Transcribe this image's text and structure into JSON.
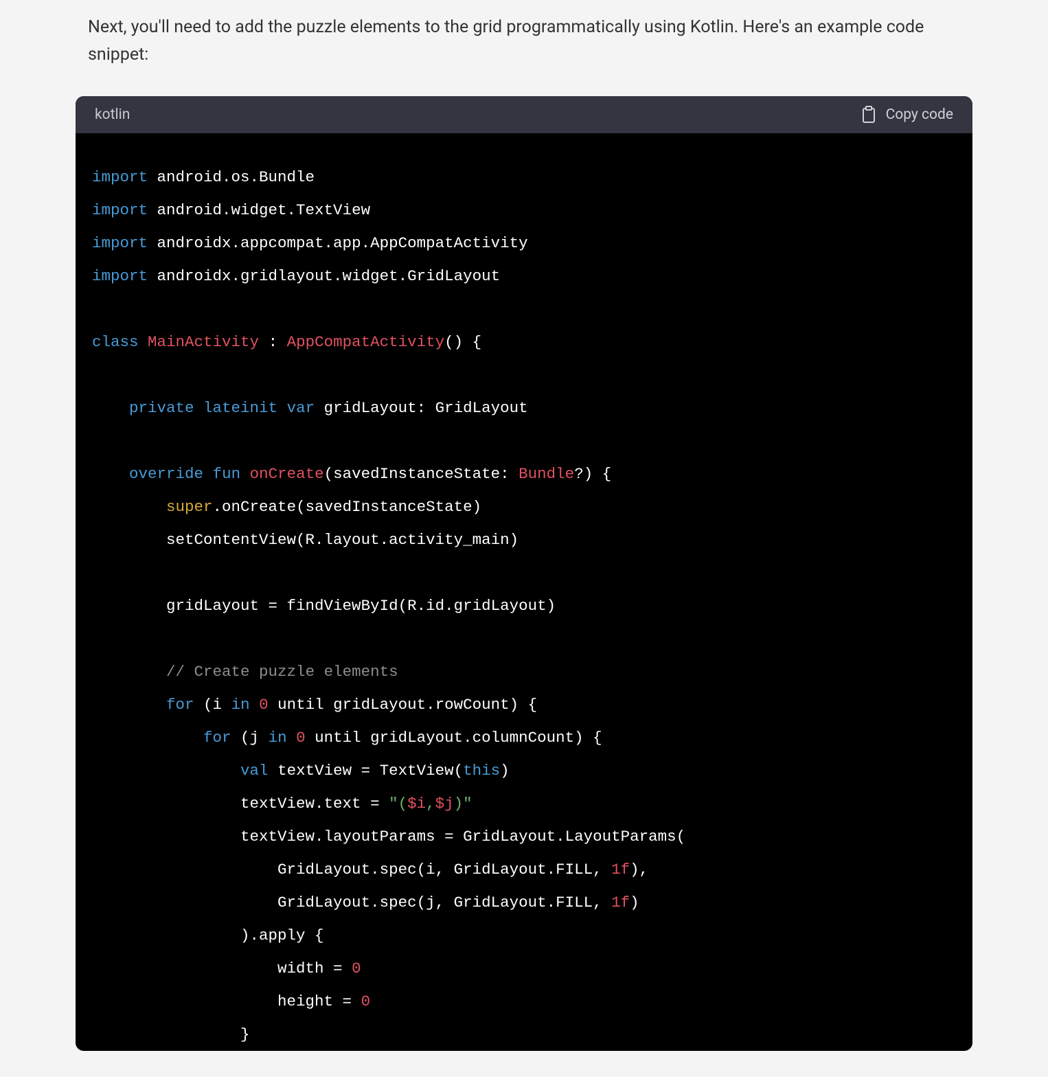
{
  "intro": "Next, you'll need to add the puzzle elements to the grid programmatically using Kotlin. Here's an example code snippet:",
  "header": {
    "language": "kotlin",
    "copy_label": "Copy code"
  },
  "code": {
    "tokens": [
      [
        [
          "import",
          "kw"
        ],
        [
          " android.os.Bundle",
          ""
        ]
      ],
      [
        [
          "import",
          "kw"
        ],
        [
          " android.widget.TextView",
          ""
        ]
      ],
      [
        [
          "import",
          "kw"
        ],
        [
          " androidx.appcompat.app.AppCompatActivity",
          ""
        ]
      ],
      [
        [
          "import",
          "kw"
        ],
        [
          " androidx.gridlayout.widget.GridLayout",
          ""
        ]
      ],
      [
        [
          "",
          ""
        ]
      ],
      [
        [
          "class",
          "kw"
        ],
        [
          " ",
          ""
        ],
        [
          "MainActivity",
          "type"
        ],
        [
          " : ",
          ""
        ],
        [
          "AppCompatActivity",
          "type"
        ],
        [
          "() {",
          ""
        ]
      ],
      [
        [
          "",
          ""
        ]
      ],
      [
        [
          "    ",
          ""
        ],
        [
          "private",
          "kw"
        ],
        [
          " ",
          ""
        ],
        [
          "lateinit",
          "kw"
        ],
        [
          " ",
          ""
        ],
        [
          "var",
          "kw"
        ],
        [
          " gridLayout: GridLayout",
          ""
        ]
      ],
      [
        [
          "",
          ""
        ]
      ],
      [
        [
          "    ",
          ""
        ],
        [
          "override",
          "kw"
        ],
        [
          " ",
          ""
        ],
        [
          "fun",
          "kw"
        ],
        [
          " ",
          ""
        ],
        [
          "onCreate",
          "type"
        ],
        [
          "(savedInstanceState: ",
          ""
        ],
        [
          "Bundle",
          "type"
        ],
        [
          "?) {",
          ""
        ]
      ],
      [
        [
          "        ",
          ""
        ],
        [
          "super",
          "super"
        ],
        [
          ".onCreate(savedInstanceState)",
          ""
        ]
      ],
      [
        [
          "        setContentView(R.layout.activity_main)",
          ""
        ]
      ],
      [
        [
          "",
          ""
        ]
      ],
      [
        [
          "        gridLayout = findViewById(R.id.gridLayout)",
          ""
        ]
      ],
      [
        [
          "",
          ""
        ]
      ],
      [
        [
          "        ",
          ""
        ],
        [
          "// Create puzzle elements",
          "comment"
        ]
      ],
      [
        [
          "        ",
          ""
        ],
        [
          "for",
          "kw"
        ],
        [
          " (i ",
          ""
        ],
        [
          "in",
          "kw"
        ],
        [
          " ",
          ""
        ],
        [
          "0",
          "num"
        ],
        [
          " until gridLayout.rowCount) {",
          ""
        ]
      ],
      [
        [
          "            ",
          ""
        ],
        [
          "for",
          "kw"
        ],
        [
          " (j ",
          ""
        ],
        [
          "in",
          "kw"
        ],
        [
          " ",
          ""
        ],
        [
          "0",
          "num"
        ],
        [
          " until gridLayout.columnCount) {",
          ""
        ]
      ],
      [
        [
          "                ",
          ""
        ],
        [
          "val",
          "kw"
        ],
        [
          " textView = TextView(",
          ""
        ],
        [
          "this",
          "kw"
        ],
        [
          ")",
          ""
        ]
      ],
      [
        [
          "                textView.text = ",
          ""
        ],
        [
          "\"(",
          "str"
        ],
        [
          "$i",
          "type"
        ],
        [
          ",",
          "str"
        ],
        [
          "$j",
          "type"
        ],
        [
          ")\"",
          "str"
        ]
      ],
      [
        [
          "                textView.layoutParams = GridLayout.LayoutParams(",
          ""
        ]
      ],
      [
        [
          "                    GridLayout.spec(i, GridLayout.FILL, ",
          ""
        ],
        [
          "1f",
          "num"
        ],
        [
          "),",
          ""
        ]
      ],
      [
        [
          "                    GridLayout.spec(j, GridLayout.FILL, ",
          ""
        ],
        [
          "1f",
          "num"
        ],
        [
          ")",
          ""
        ]
      ],
      [
        [
          "                ).apply {",
          ""
        ]
      ],
      [
        [
          "                    width = ",
          ""
        ],
        [
          "0",
          "num"
        ]
      ],
      [
        [
          "                    height = ",
          ""
        ],
        [
          "0",
          "num"
        ]
      ],
      [
        [
          "                }",
          ""
        ]
      ]
    ]
  }
}
